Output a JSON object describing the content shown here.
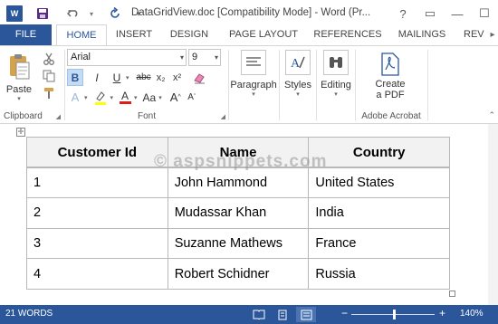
{
  "titlebar": {
    "app_icon": "W",
    "title": "DataGridView.doc [Compatibility Mode] - Word (Pr...",
    "window_buttons": [
      "?",
      "▭",
      "—",
      "☐"
    ]
  },
  "tabs": [
    {
      "label": "FILE"
    },
    {
      "label": "HOME"
    },
    {
      "label": "INSERT"
    },
    {
      "label": "DESIGN"
    },
    {
      "label": "PAGE LAYOUT"
    },
    {
      "label": "REFERENCES"
    },
    {
      "label": "MAILINGS"
    },
    {
      "label": "REV"
    }
  ],
  "ribbon": {
    "clipboard": {
      "paste_label": "Paste",
      "group_label": "Clipboard"
    },
    "font": {
      "font_name": "Arial",
      "font_size": "9",
      "group_label": "Font",
      "bold": "B",
      "italic": "I",
      "underline": "U",
      "strike": "abc",
      "subscript": "x₂",
      "superscript": "x²",
      "grow": "A",
      "shrink": "A",
      "case": "Aa",
      "color_a": "A"
    },
    "paragraph": {
      "label": "Paragraph"
    },
    "styles": {
      "label": "Styles"
    },
    "editing": {
      "label": "Editing"
    },
    "acrobat": {
      "button_line1": "Create",
      "button_line2": "a PDF",
      "group_label": "Adobe Acrobat"
    }
  },
  "document": {
    "watermark": "© aspsnippets.com",
    "table": {
      "headers": [
        "Customer Id",
        "Name",
        "Country"
      ],
      "rows": [
        [
          "1",
          "John Hammond",
          "United States"
        ],
        [
          "2",
          "Mudassar Khan",
          "India"
        ],
        [
          "3",
          "Suzanne Mathews",
          "France"
        ],
        [
          "4",
          "Robert Schidner",
          "Russia"
        ]
      ]
    }
  },
  "statusbar": {
    "word_count": "21 WORDS",
    "zoom_percent": "140%",
    "zoom_level": 1.4
  },
  "colors": {
    "accent": "#2b579a",
    "status_bar": "#2b579a"
  }
}
